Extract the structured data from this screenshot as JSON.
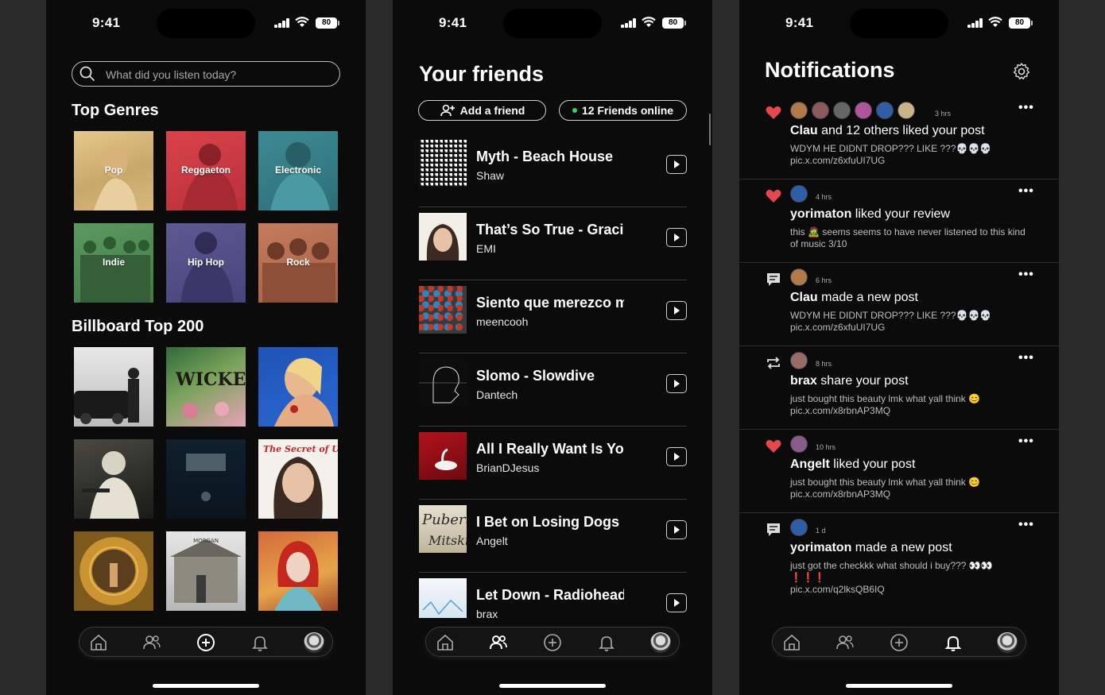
{
  "status_bar": {
    "time": "9:41",
    "battery": "80"
  },
  "discover": {
    "search_placeholder": "What did you listen today?",
    "top_genres_title": "Top Genres",
    "genres": [
      "Pop",
      "Reggaeton",
      "Electronic",
      "Indie",
      "Hip Hop",
      "Rock"
    ],
    "billboard_title": "Billboard Top 200"
  },
  "friends": {
    "title": "Your friends",
    "add_friend_label": "Add a friend",
    "online_label": "12 Friends online",
    "rows": [
      {
        "song": "Myth - Beach House",
        "user": "Shaw"
      },
      {
        "song": "That’s So True - Gracie Abrams",
        "user": "EMI"
      },
      {
        "song": "Siento que merezco más",
        "user": "meencooh"
      },
      {
        "song": "Slomo - Slowdive",
        "user": "Dantech"
      },
      {
        "song": "All I Really Want Is You",
        "user": "BrianDJesus"
      },
      {
        "song": "I Bet on Losing Dogs",
        "user": "Angelt"
      },
      {
        "song": "Let Down - Radiohead",
        "user": "brax"
      }
    ]
  },
  "notifications": {
    "title": "Notifications",
    "more_glyph": "•••",
    "items": [
      {
        "kind": "like",
        "ago": "3 hrs",
        "actor": "Clau",
        "action": " and 12 others liked your post",
        "body": "WDYM HE DIDNT DROP??? LIKE ???💀💀💀",
        "link": "pic.x.com/z6xfuUI7UG"
      },
      {
        "kind": "like",
        "ago": "4 hrs",
        "actor": "yorimaton",
        "action": " liked your review",
        "body": "this 🧟 seems seems to have never listened to this kind of music 3/10",
        "link": ""
      },
      {
        "kind": "post",
        "ago": "6 hrs",
        "actor": "Clau",
        "action": " made a new post",
        "body": "WDYM HE DIDNT DROP??? LIKE ???💀💀💀",
        "link": "pic.x.com/z6xfuUI7UG"
      },
      {
        "kind": "share",
        "ago": "8 hrs",
        "actor": "brax",
        "action": " share your post",
        "body": "just bought this beauty lmk what yall think 😊",
        "link": "pic.x.com/x8rbnAP3MQ"
      },
      {
        "kind": "like",
        "ago": "10 hrs",
        "actor": "Angelt",
        "action": " liked your post",
        "body": "just bought this beauty lmk what yall think 😊",
        "link": "pic.x.com/x8rbnAP3MQ"
      },
      {
        "kind": "post",
        "ago": "1 d",
        "actor": "yorimaton",
        "action": " made a new post",
        "body": "just got the checkkk what should i buy??? 👀👀 ❗❗❗",
        "link": "pic.x.com/q2lksQB6IQ"
      }
    ]
  },
  "colors": {
    "background": "#0b0b0b",
    "accent_heart": "#e5484d",
    "online_dot": "#35d36a"
  }
}
